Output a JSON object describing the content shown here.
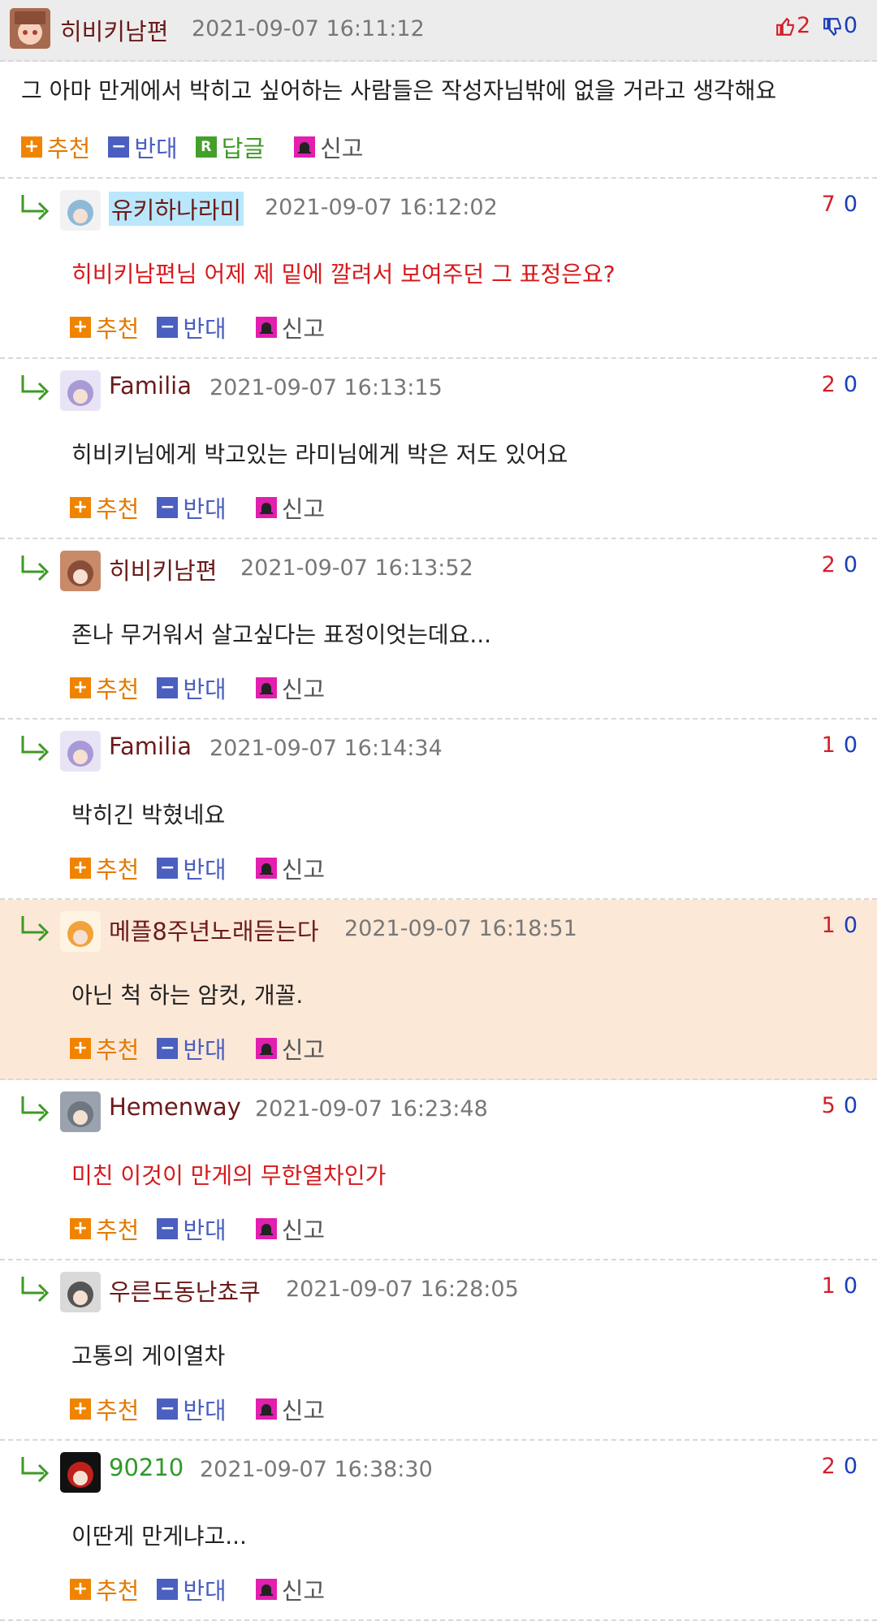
{
  "top_comment": {
    "nick": "히비키남편",
    "date": "2021-09-07 16:11:12",
    "up": "2",
    "down": "0",
    "text": "그 아마 만게에서 박히고 싶어하는 사람들은 작성자님밖에 없을 거라고 생각해요",
    "actions": {
      "up": "추천",
      "down": "반대",
      "reply": "답글",
      "report": "신고"
    }
  },
  "actions": {
    "up": "추천",
    "down": "반대",
    "report": "신고"
  },
  "replies": [
    {
      "nick": "유키하나라미",
      "date": "2021-09-07 16:12:02",
      "up": "7",
      "down": "0",
      "text": "히비키남편님 어제 제 밑에 깔려서 보여주던 그 표정은요?"
    },
    {
      "nick": "Familia",
      "date": "2021-09-07 16:13:15",
      "up": "2",
      "down": "0",
      "text": "히비키님에게 박고있는 라미님에게 박은 저도 있어요"
    },
    {
      "nick": "히비키남편",
      "date": "2021-09-07 16:13:52",
      "up": "2",
      "down": "0",
      "text": "존나 무거워서 살고싶다는 표정이엇는데요..."
    },
    {
      "nick": "Familia",
      "date": "2021-09-07 16:14:34",
      "up": "1",
      "down": "0",
      "text": "박히긴 박혔네요"
    },
    {
      "nick": "메플8주년노래듣는다",
      "date": "2021-09-07 16:18:51",
      "up": "1",
      "down": "0",
      "text": "아닌 척 하는 암컷, 개꼴."
    },
    {
      "nick": "Hemenway",
      "date": "2021-09-07 16:23:48",
      "up": "5",
      "down": "0",
      "text": "미친 이것이 만게의 무한열차인가"
    },
    {
      "nick": "우른도동난쵸쿠",
      "date": "2021-09-07 16:28:05",
      "up": "1",
      "down": "0",
      "text": "고통의 게이열차"
    },
    {
      "nick": "90210",
      "date": "2021-09-07 16:38:30",
      "up": "2",
      "down": "0",
      "text": "이딴게 만게냐고..."
    }
  ],
  "colors": {
    "nick": "#6b1a1a",
    "red_text": "#d7191c",
    "highlight_bg": "#fce8d7",
    "up": "#d41f2a",
    "down": "#1a3eb8"
  }
}
